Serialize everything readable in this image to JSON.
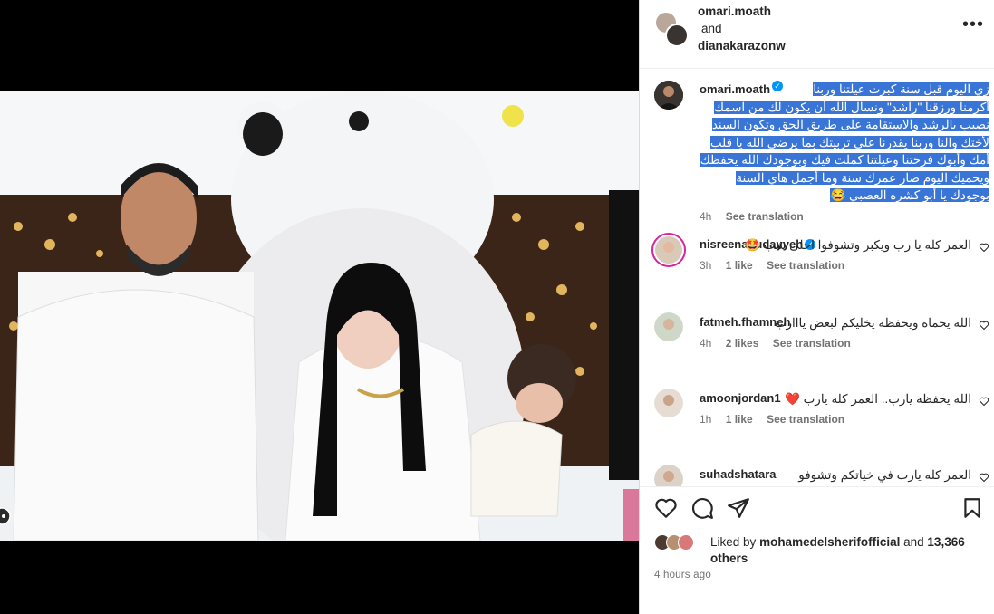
{
  "header": {
    "user1": "omari.moath",
    "joiner": "and",
    "user2": "dianakarazonw",
    "more_icon": "more-horizontal-icon",
    "more_label": "•••"
  },
  "caption": {
    "username": "omari.moath",
    "verified": true,
    "text": "زي اليوم قبل سنة كبرت عيلتنا وربنا أكرمنا ورزقنا \"راشد\" ونسأل الله أن يكون لك من اسمك نصيب بالرشد والاستقامة على طريق الحق وتكون السند لأختك والنا وربنا يقدرنا على تربيتك بما يرضى الله يا قلب أمك وأبوك فرحتنا وعيلتنا كملت فيك وبوجودك الله يحفظك ويحميك اليوم صار عمرك سنة وما أجمل هاي السنة بوجودك يا أبو كشره العصبي 😂",
    "time": "4h",
    "see_translation": "See translation"
  },
  "comments": [
    {
      "username": "nisreenabudayyeh",
      "verified": true,
      "text": "العمر كله يا رب ويكبر وتشوفوا احلى شب 🤩",
      "time": "3h",
      "likes": "1 like",
      "see_translation": "See translation"
    },
    {
      "username": "fatmeh.fhamneh",
      "verified": false,
      "text": "الله يحماه ويحفظه يخليكم لبعض يااارب",
      "time": "4h",
      "likes": "2 likes",
      "see_translation": "See translation"
    },
    {
      "username": "amoonjordan1",
      "verified": false,
      "text": "الله يحفظه يارب.. العمر كله يارب ❤️",
      "time": "1h",
      "likes": "1 like",
      "see_translation": "See translation"
    },
    {
      "username": "suhadshatara",
      "verified": false,
      "text": "العمر كله يارب في خياتكم وتشوفو",
      "time": "",
      "likes": "",
      "see_translation": ""
    }
  ],
  "actions": {
    "like_icon": "heart-icon",
    "comment_icon": "comment-icon",
    "share_icon": "send-icon",
    "save_icon": "bookmark-icon"
  },
  "likes": {
    "prefix": "Liked by",
    "user": "mohamedelsherifofficial",
    "joiner": "and",
    "count": "13,366",
    "suffix": "others"
  },
  "posted": "4 hours ago",
  "colors": {
    "accent": "#0095f6",
    "highlight": "#3875d7",
    "secondary_text": "#737373",
    "heart_red": "#ed4956"
  }
}
